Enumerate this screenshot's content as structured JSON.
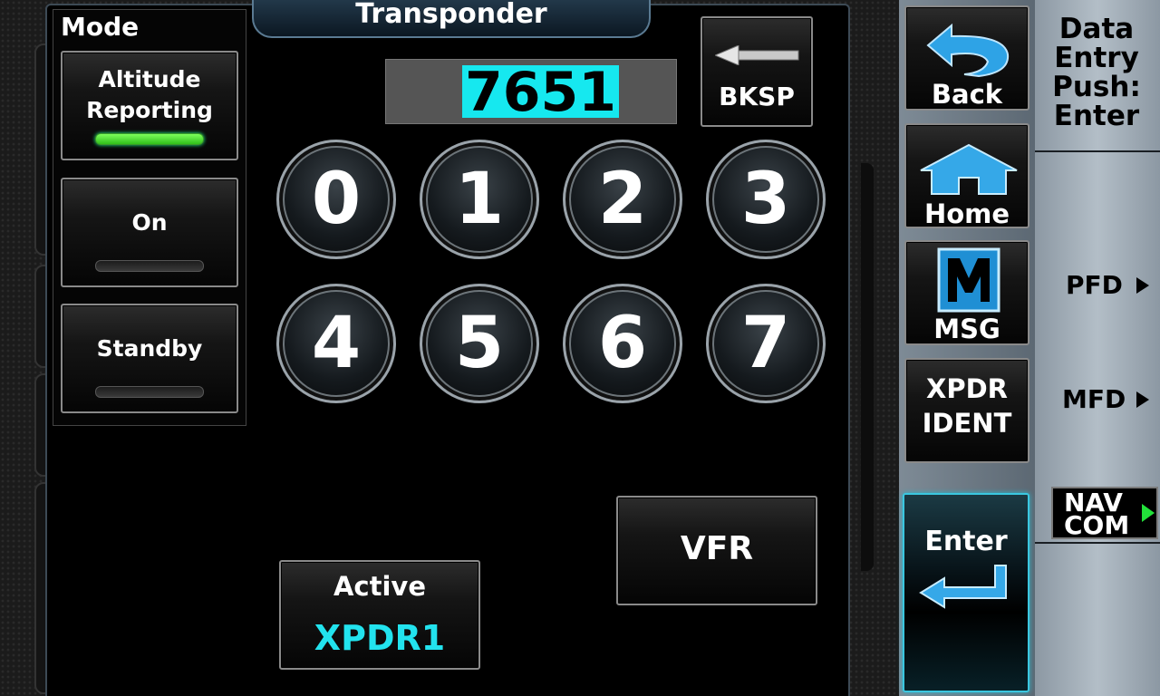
{
  "title": "Transponder",
  "mode": {
    "label": "Mode",
    "buttons": [
      {
        "label_line1": "Altitude",
        "label_line2": "Reporting",
        "indicator": "on"
      },
      {
        "label": "On",
        "indicator": "off"
      },
      {
        "label": "Standby",
        "indicator": "off"
      }
    ]
  },
  "code_entry": {
    "value": "7651",
    "highlight_color": "#16e8ef"
  },
  "backspace": {
    "label": "BKSP"
  },
  "keypad": {
    "keys": [
      "0",
      "1",
      "2",
      "3",
      "4",
      "5",
      "6",
      "7"
    ]
  },
  "vfr": {
    "label": "VFR"
  },
  "active": {
    "label": "Active",
    "value": "XPDR1",
    "value_color": "#22e3ee"
  },
  "rail": {
    "back": {
      "label": "Back",
      "icon": "back-arrow-icon"
    },
    "home": {
      "label": "Home",
      "icon": "home-icon"
    },
    "msg": {
      "label": "MSG",
      "icon": "msg-icon"
    },
    "xpdr_ident": {
      "line1": "XPDR",
      "line2": "IDENT"
    },
    "enter": {
      "label": "Enter",
      "icon": "enter-arrow-icon"
    }
  },
  "info": {
    "lines": [
      "Data",
      "Entry",
      "Push:",
      "Enter"
    ],
    "pfd": "PFD",
    "mfd": "MFD",
    "navcom_line1": "NAV",
    "navcom_line2": "COM",
    "navcom_arrow_color": "#22e13a"
  }
}
